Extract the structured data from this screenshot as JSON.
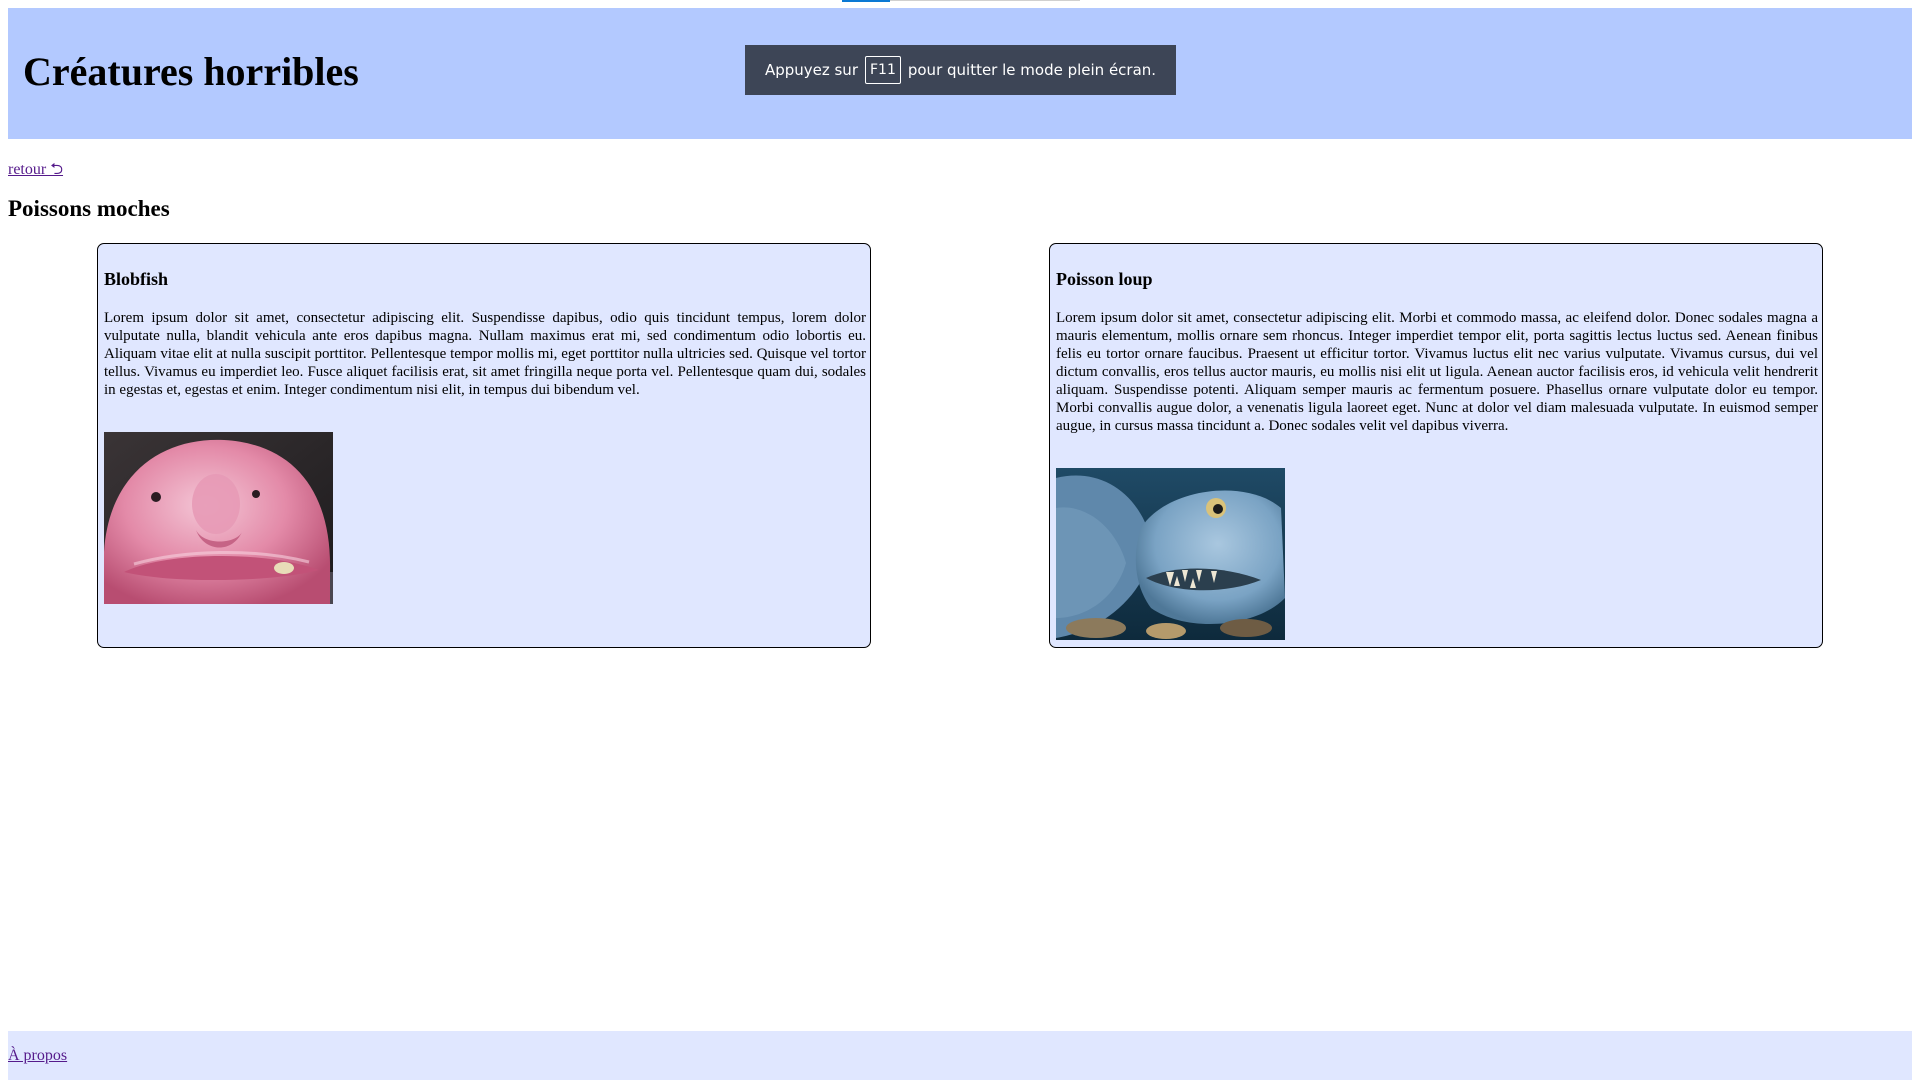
{
  "header": {
    "title": "Créatures horribles"
  },
  "fullscreen_notice": {
    "before": "Appuyez sur",
    "key": "F11",
    "after": "pour quitter le mode plein écran."
  },
  "nav": {
    "back_label": "retour ⮌"
  },
  "section": {
    "title": "Poissons moches"
  },
  "cards": [
    {
      "title": "Blobfish",
      "text": "Lorem ipsum dolor sit amet, consectetur adipiscing elit. Suspendisse dapibus, odio quis tincidunt tempus, lorem dolor vulputate nulla, blandit vehicula ante eros dapibus magna. Nullam maximus erat mi, sed condimentum odio lobortis eu. Aliquam vitae elit at nulla suscipit porttitor. Pellentesque tempor mollis mi, eget porttitor nulla ultricies sed. Quisque vel tortor tellus. Vivamus eu imperdiet leo. Fusce aliquet facilisis erat, sit amet fringilla neque porta vel. Pellentesque quam dui, sodales in egestas et, egestas et enim. Integer condimentum nisi elit, in tempus dui bibendum vel.",
      "image": "blobfish-photo"
    },
    {
      "title": "Poisson loup",
      "text": "Lorem ipsum dolor sit amet, consectetur adipiscing elit. Morbi et commodo massa, ac eleifend dolor. Donec sodales magna a mauris elementum, mollis ornare sem rhoncus. Integer imperdiet tempor elit, porta sagittis lectus luctus sed. Aenean finibus felis eu tortor ornare faucibus. Praesent ut efficitur tortor. Vivamus luctus elit nec varius vulputate. Vivamus cursus, dui vel dictum convallis, eros tellus auctor mauris, eu mollis nisi elit ut ligula. Aenean auctor facilisis eros, id vehicula velit hendrerit aliquam. Suspendisse potenti. Aliquam semper mauris ac fermentum posuere. Phasellus ornare vulputate dolor eu tempor. Morbi convallis augue dolor, a venenatis ligula laoreet eget. Nunc at dolor vel diam malesuada vulputate. In euismod semper augue, in cursus massa tincidunt a. Donec sodales velit vel dapibus viverra.",
      "image": "wolffish-photo"
    }
  ],
  "footer": {
    "about_label": "À propos"
  },
  "colors": {
    "header_bg": "#b3c9ff",
    "card_bg": "#e0e7ff",
    "footer_bg": "#e0e7ff",
    "toast_bg": "#3d4556",
    "visited_link": "#551a8b"
  }
}
